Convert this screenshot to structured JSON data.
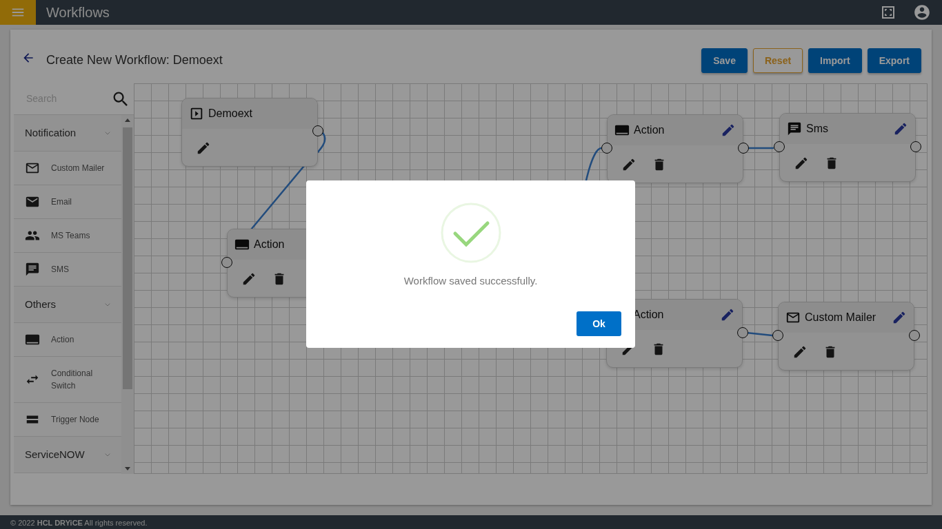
{
  "app_bar": {
    "title": "Workflows"
  },
  "page": {
    "title": "Create New Workflow: Demoext"
  },
  "buttons": [
    {
      "label": "Save",
      "kind": "primary"
    },
    {
      "label": "Reset",
      "kind": "outline"
    },
    {
      "label": "Import",
      "kind": "primary"
    },
    {
      "label": "Export",
      "kind": "primary"
    }
  ],
  "palette": {
    "search": {
      "placeholder": "Search"
    },
    "groups": [
      {
        "label": "Notification",
        "items": [
          {
            "label": "Custom Mailer",
            "kind": "mail-outline"
          },
          {
            "label": "Email",
            "kind": "mail"
          },
          {
            "label": "MS Teams",
            "kind": "people"
          },
          {
            "label": "SMS",
            "kind": "chat"
          }
        ]
      },
      {
        "label": "Others",
        "items": [
          {
            "label": "Action",
            "kind": "action"
          },
          {
            "label": "Conditional Switch",
            "kind": "switch"
          },
          {
            "label": "Trigger Node",
            "kind": "trigger"
          }
        ]
      },
      {
        "label": "ServiceNOW"
      }
    ]
  },
  "nodes": [
    {
      "title": "Demoext",
      "kind": "trigger"
    },
    {
      "title": "Action",
      "kind": "action"
    },
    {
      "title": "Action",
      "kind": "action"
    },
    {
      "title": "Sms",
      "kind": "chat"
    },
    {
      "title": "Action",
      "kind": "action"
    },
    {
      "title": "Custom Mailer",
      "kind": "mail-outline"
    }
  ],
  "dialog": {
    "message": "Workflow saved successfully.",
    "button": "Ok"
  },
  "footer": {
    "copyright": "© 2022 **HCL DRYiCE** All rights reserved."
  }
}
